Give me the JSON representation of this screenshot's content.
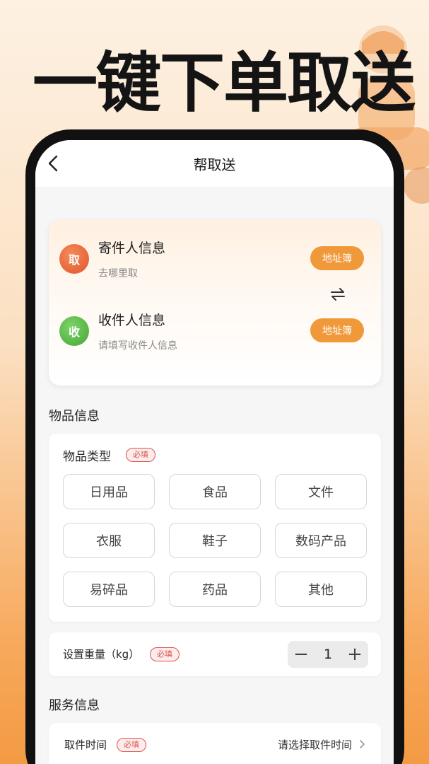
{
  "headline": "一键下单取送",
  "nav": {
    "title": "帮取送"
  },
  "sender": {
    "badge": "取",
    "title": "寄件人信息",
    "subtitle": "去哪里取",
    "button": "地址簿"
  },
  "receiver": {
    "badge": "收",
    "title": "收件人信息",
    "subtitle": "请填写收件人信息",
    "button": "地址簿"
  },
  "goods_section": {
    "title": "物品信息"
  },
  "item_type": {
    "label": "物品类型",
    "required": "必填",
    "options": [
      "日用品",
      "食品",
      "文件",
      "衣服",
      "鞋子",
      "数码产品",
      "易碎品",
      "药品",
      "其他"
    ]
  },
  "weight": {
    "label": "设置重量（kg）",
    "required": "必填",
    "minus": "−",
    "value": "1",
    "plus": "+"
  },
  "service_section": {
    "title": "服务信息"
  },
  "pickup_time": {
    "label": "取件时间",
    "required": "必填",
    "placeholder": "请选择取件时间"
  },
  "colors": {
    "accent": "#f0993a",
    "required": "#d9534f",
    "pickup_badge": "#e0552b",
    "receive_badge": "#43a733"
  }
}
